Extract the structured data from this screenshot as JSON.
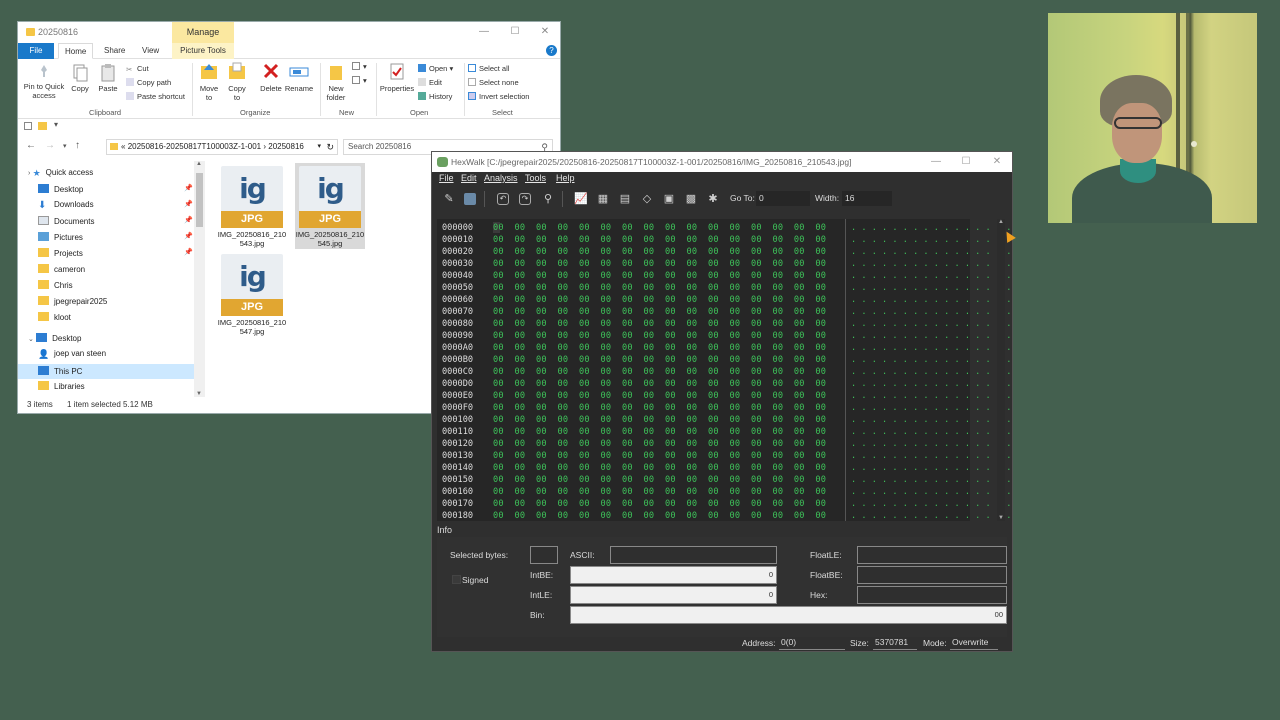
{
  "explorer": {
    "title": "20250816",
    "context_tab": "Manage",
    "tabs": {
      "file": "File",
      "home": "Home",
      "share": "Share",
      "view": "View",
      "picture_tools": "Picture Tools"
    },
    "ribbon": {
      "pin": "Pin to Quick access",
      "copy": "Copy",
      "paste": "Paste",
      "cut": "Cut",
      "copy_path": "Copy path",
      "paste_shortcut": "Paste shortcut",
      "move_to": "Move to",
      "copy_to": "Copy to",
      "delete": "Delete",
      "rename": "Rename",
      "new_folder": "New folder",
      "properties": "Properties",
      "open": "Open",
      "edit": "Edit",
      "history": "History",
      "select_all": "Select all",
      "select_none": "Select none",
      "invert_selection": "Invert selection",
      "groups": {
        "clipboard": "Clipboard",
        "organize": "Organize",
        "new": "New",
        "open": "Open",
        "select": "Select"
      }
    },
    "address": "20250816-20250817T100003Z-1-001  ›  20250816",
    "address_prefix": "«",
    "search_placeholder": "Search 20250816",
    "nav": [
      {
        "label": "Quick access"
      },
      {
        "label": "Desktop"
      },
      {
        "label": "Downloads"
      },
      {
        "label": "Documents"
      },
      {
        "label": "Pictures"
      },
      {
        "label": "Projects"
      },
      {
        "label": "cameron"
      },
      {
        "label": "Chris"
      },
      {
        "label": "jpegrepair2025"
      },
      {
        "label": "kloot"
      },
      {
        "label": "Desktop"
      },
      {
        "label": "joep van steen"
      },
      {
        "label": "This PC"
      },
      {
        "label": "Libraries"
      }
    ],
    "files": [
      {
        "badge": "JPG",
        "logo": "ig",
        "name": "IMG_20250816_210543.jpg"
      },
      {
        "badge": "JPG",
        "logo": "ig",
        "name": "IMG_20250816_210545.jpg"
      },
      {
        "badge": "JPG",
        "logo": "ig",
        "name": "IMG_20250816_210547.jpg"
      }
    ],
    "status": {
      "count": "3 items",
      "selected": "1 item selected  5.12 MB"
    }
  },
  "hexwalk": {
    "title": "HexWalk [C:/jpegrepair2025/20250816-20250817T100003Z-1-001/20250816/IMG_20250816_210543.jpg]",
    "menu": {
      "file": "File",
      "edit": "Edit",
      "analysis": "Analysis",
      "tools": "Tools",
      "help": "Help"
    },
    "toolbar": {
      "goto_label": "Go To:",
      "goto_value": "0",
      "width_label": "Width:",
      "width_value": "16"
    },
    "offsets": [
      "000000",
      "000010",
      "000020",
      "000030",
      "000040",
      "000050",
      "000060",
      "000070",
      "000080",
      "000090",
      "0000A0",
      "0000B0",
      "0000C0",
      "0000D0",
      "0000E0",
      "0000F0",
      "000100",
      "000110",
      "000120",
      "000130",
      "000140",
      "000150",
      "000160",
      "000170",
      "000180"
    ],
    "byte_value": "00",
    "ascii_char": ".",
    "info": {
      "section": "Info",
      "selected_bytes": "Selected bytes:",
      "ascii": "ASCII:",
      "signed": "Signed",
      "intbe": "IntBE:",
      "intbe_value": "0",
      "intle": "IntLE:",
      "intle_value": "0",
      "bin": "Bin:",
      "bin_value": "00",
      "floatle": "FloatLE:",
      "floatbe": "FloatBE:",
      "hex": "Hex:"
    },
    "status": {
      "address_label": "Address:",
      "address_value": "0(0)",
      "size_label": "Size:",
      "size_value": "5370781",
      "mode_label": "Mode:",
      "mode_value": "Overwrite"
    }
  }
}
